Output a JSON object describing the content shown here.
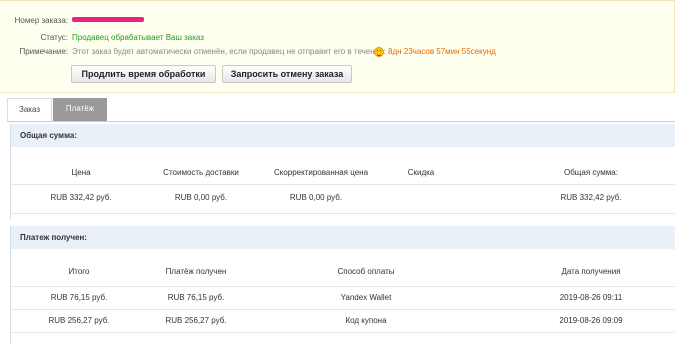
{
  "order": {
    "number_label": "Номер заказа:",
    "status_label": "Статус:",
    "status_value": "Продавец обрабатывает Ваш заказ",
    "note_label": "Примечание:",
    "note_text": "Этот заказ будет автоматически отменён, если продавец не отправит его в течение:",
    "timer": "8дн 23часов 57мин 55секунд",
    "status_color": "#2a9a2a",
    "timer_color": "#e66a00",
    "redaction_color": "#e8227e"
  },
  "buttons": {
    "extend": "Продлить время обработки",
    "cancel": "Запросить отмену заказа"
  },
  "tabs": [
    {
      "label": "Заказ",
      "active": false
    },
    {
      "label": "Платёж",
      "active": true
    }
  ],
  "total_section": {
    "title": "Общая сумма:",
    "headers": [
      "Цена",
      "Стоимость доставки",
      "Скорректированная цена",
      "Скидка",
      "Общая сумма:"
    ],
    "row": [
      "RUB 332,42 руб.",
      "RUB 0,00 руб.",
      "RUB 0,00 руб.",
      "",
      "RUB 332,42 руб."
    ]
  },
  "payment_section": {
    "title": "Платеж получен:",
    "headers": [
      "Итого",
      "Платёж получен",
      "Способ оплаты",
      "Дата получения"
    ],
    "rows": [
      [
        "RUB 76,15 руб.",
        "RUB 76,15 руб.",
        "Yandex Wallet",
        "2019-08-26 09:11"
      ],
      [
        "RUB 256,27 руб.",
        "RUB 256,27 руб.",
        "Код купона",
        "2019-08-26 09:09"
      ]
    ]
  }
}
